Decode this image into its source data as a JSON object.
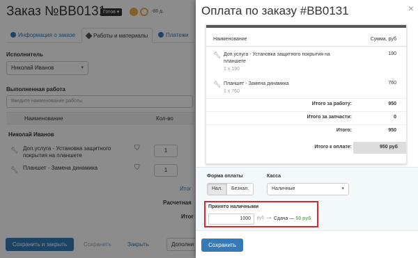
{
  "background": {
    "title": "Заказ №BB0131",
    "status_label": "Готов",
    "status_chevron": "▾",
    "status_icons": [
      "warning-icon",
      "clock-icon"
    ],
    "stat_text": "-86 д.",
    "tabs": [
      {
        "label": "Информация о заказе",
        "icon": "info-icon"
      },
      {
        "label": "Работы и материалы",
        "icon": "wrench-icon"
      },
      {
        "label": "Платежи",
        "icon": "payment-icon"
      }
    ],
    "executor_label": "Исполнитель",
    "executor_value": "Николай Иванов",
    "work_label": "Выполненная работа",
    "work_placeholder": "Введите наименование работы",
    "table_headers": {
      "name": "Наименование",
      "qty": "Кол-во"
    },
    "group": "Николай Иванов",
    "rows": [
      {
        "name": "Доп.услуга - Установка защитного покрытия на планшете",
        "qty": "1"
      },
      {
        "name": "Планшет - Замена динамика",
        "qty": "1"
      }
    ],
    "side_texts": [
      "Итог",
      "Расчетная",
      "Итог"
    ],
    "footer": {
      "save_close": "Сохранить и закрыть",
      "save": "Сохранить",
      "close": "Закрыть",
      "more": "Дополни"
    }
  },
  "modal": {
    "title": "Оплата по заказу #BB0131",
    "close_glyph": "×",
    "receipt": {
      "col_name": "Наименование",
      "col_sum": "Сумма, руб",
      "items": [
        {
          "name": "Доп.услуга - Установка защитного покрытия на планшете",
          "sub": "1 x 190",
          "amount": "190"
        },
        {
          "name": "Планшет - Замена динамика",
          "sub": "1 x 760",
          "amount": "760"
        }
      ],
      "totals": [
        {
          "label": "Итого за работу:",
          "value": "950"
        },
        {
          "label": "Итого за запчасти:",
          "value": "0"
        },
        {
          "label": "Итого:",
          "value": "950"
        }
      ],
      "grand_label": "Итого к оплате:",
      "grand_value": "950 руб"
    },
    "payment": {
      "form_label": "Форма оплаты",
      "form_options": [
        "Нал.",
        "Безнал."
      ],
      "form_selected": "Нал.",
      "cashbox_label": "Касса",
      "cashbox_value": "Наличные",
      "received_label": "Принято наличными",
      "received_value": "1000",
      "currency": "руб",
      "arrow": "→",
      "change_label": "Сдача —",
      "change_value": "50 руб"
    },
    "save_button": "Сохранить"
  },
  "colors": {
    "primary": "#337ab7",
    "highlight": "#d9262c",
    "change": "#5cb85c"
  }
}
